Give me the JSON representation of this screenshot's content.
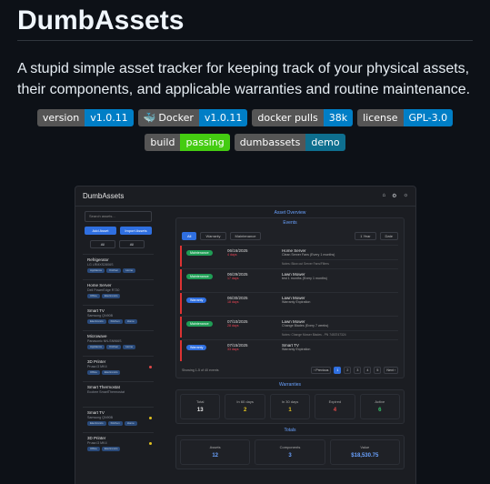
{
  "readme": {
    "title": "DumbAssets",
    "description": "A stupid simple asset tracker for keeping track of your physical assets, their components, and applicable warranties and routine maintenance."
  },
  "badges": [
    {
      "label": "version",
      "value": "v1.0.11",
      "color": "blue"
    },
    {
      "label": "Docker",
      "value": "v1.0.11",
      "color": "blue",
      "icon": "docker-whale-icon"
    },
    {
      "label": "docker pulls",
      "value": "38k",
      "color": "blue"
    },
    {
      "label": "license",
      "value": "GPL-3.0",
      "color": "blue"
    },
    {
      "label": "build",
      "value": "passing",
      "color": "green"
    },
    {
      "label": "dumbassets",
      "value": "demo",
      "color": "teal"
    }
  ],
  "app": {
    "title": "DumbAssets",
    "header_icons": [
      "home-icon",
      "gear-icon",
      "sun-icon"
    ],
    "sidebar": {
      "search_placeholder": "Search assets...",
      "add_asset": "Add Asset",
      "import_assets": "Import Assets",
      "filter_a": "All",
      "filter_b": "All",
      "assets": [
        {
          "name": "Refrigerator",
          "model": "LG LRMXS2806S",
          "tags": [
            "Appliance",
            "Kitchen",
            "Home"
          ],
          "dot": ""
        },
        {
          "name": "Home Server",
          "model": "Dell PowerEdge R730",
          "tags": [
            "Office",
            "Electronics"
          ],
          "dot": ""
        },
        {
          "name": "Smart TV",
          "model": "Samsung QN90B",
          "tags": [
            "Electronics",
            "Kitchen",
            "Home"
          ],
          "dot": ""
        },
        {
          "name": "Microwave",
          "model": "Panasonic NN-SN966S",
          "tags": [
            "Appliance",
            "Kitchen",
            "Home"
          ],
          "dot": ""
        },
        {
          "name": "3D Printer",
          "model": "Prusa i3 MK4",
          "tags": [
            "Office",
            "Electronics"
          ],
          "dot": "#e04848"
        },
        {
          "name": "Smart Thermostat",
          "model": "Ecobee SmartThermostat",
          "tags": [],
          "dot": ""
        },
        {
          "name": "Smart TV",
          "model": "Samsung QN90B",
          "tags": [
            "Electronics",
            "Kitchen",
            "Home"
          ],
          "dot": "#e0c020"
        },
        {
          "name": "3D Printer",
          "model": "Prusa i3 MK4",
          "tags": [
            "Office",
            "Electronics"
          ],
          "dot": "#e0c020"
        }
      ]
    },
    "overview_label": "Asset Overview",
    "events_label": "Events",
    "event_filters": [
      "All",
      "Warranty",
      "Maintenance"
    ],
    "event_range": "1 Year",
    "event_sort": "Date",
    "events": [
      {
        "type": "Maintenance",
        "kind": "mt",
        "date": "06/16/2025",
        "status": "4 days",
        "asset": "Home Server",
        "detail": "Clean Server Fans (Every 1 months)",
        "note": "Notes: Blow out Server Fans/Filters"
      },
      {
        "type": "Maintenance",
        "kind": "mt",
        "date": "06/29/2025",
        "status": "17 days",
        "asset": "Lawn Mower",
        "detail": "test 1 months (Every 1 months)",
        "note": ""
      },
      {
        "type": "Warranty",
        "kind": "wr",
        "date": "06/30/2025",
        "status": "18 days",
        "asset": "Lawn Mower",
        "detail": "Warranty Expiration",
        "note": ""
      },
      {
        "type": "Maintenance",
        "kind": "mt",
        "date": "07/10/2025",
        "status": "28 days",
        "asset": "Lawn Mower",
        "detail": "Change Blades (Every 7 weeks)",
        "note": "Notes: Change Mower Blades - PN 7453747324"
      },
      {
        "type": "Warranty",
        "kind": "wr",
        "date": "07/15/2025",
        "status": "33 days",
        "asset": "Smart TV",
        "detail": "Warranty Expiration",
        "note": ""
      }
    ],
    "pager_text": "Showing 1-5 of 40 events",
    "pager": {
      "prev": "‹ Previous",
      "pages": [
        "1",
        "2",
        "3",
        "4",
        "5"
      ],
      "next": "Next ›"
    },
    "warranties_label": "Warranties",
    "warranties": [
      {
        "label": "Total",
        "value": "13",
        "color": "#e6e6e6"
      },
      {
        "label": "In 60 days",
        "value": "2",
        "color": "#e0c020"
      },
      {
        "label": "In 30 days",
        "value": "1",
        "color": "#e0c020"
      },
      {
        "label": "Expired",
        "value": "4",
        "color": "#e04848"
      },
      {
        "label": "Active",
        "value": "6",
        "color": "#35c16a"
      }
    ],
    "totals_label": "Totals",
    "totals": [
      {
        "label": "Assets",
        "value": "12",
        "color": "#6aa2ff"
      },
      {
        "label": "Components",
        "value": "3",
        "color": "#6aa2ff"
      },
      {
        "label": "Value",
        "value": "$18,530.75",
        "color": "#6aa2ff"
      }
    ]
  }
}
